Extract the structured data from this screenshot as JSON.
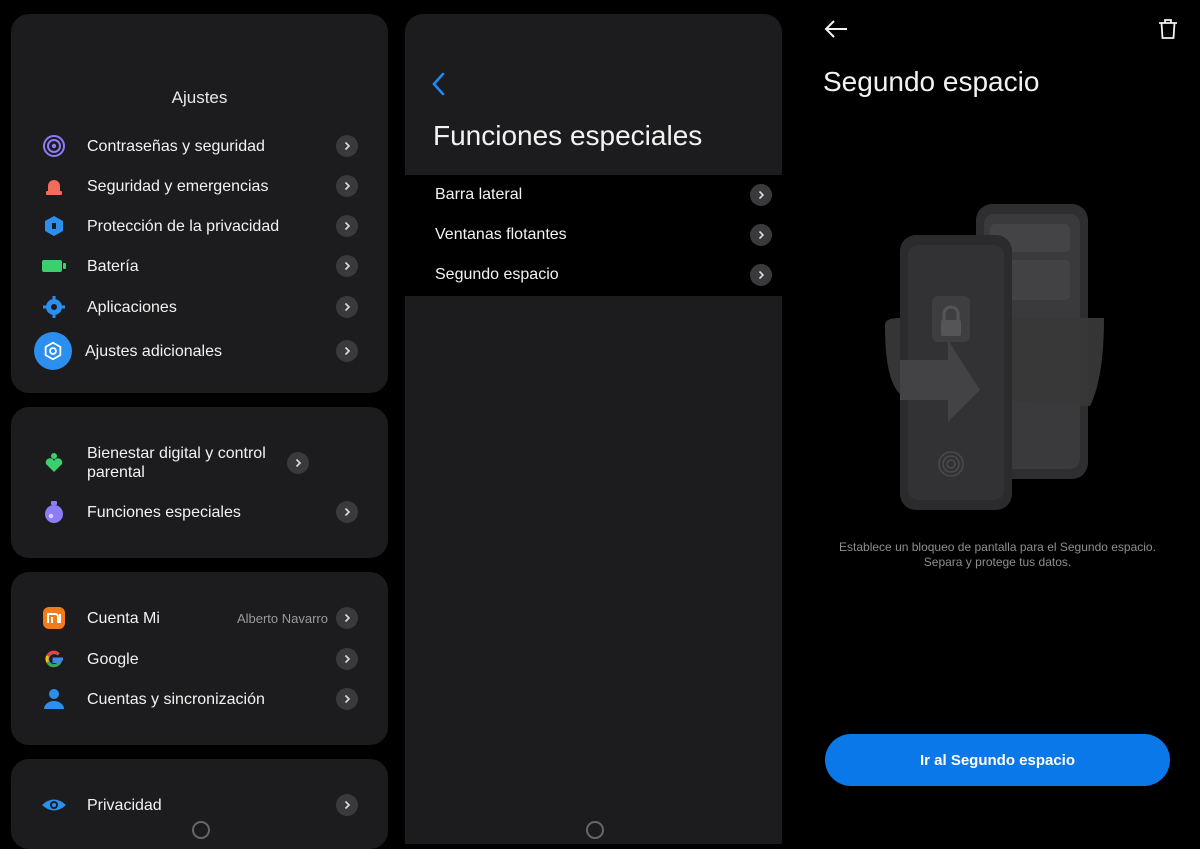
{
  "settings": {
    "title": "Ajustes",
    "group1": [
      {
        "label": "Contraseñas y seguridad",
        "icon": "fingerprint-icon"
      },
      {
        "label": "Seguridad y emergencias",
        "icon": "emergency-bell-icon"
      },
      {
        "label": "Protección de la privacidad",
        "icon": "privacy-shield-icon"
      },
      {
        "label": "Batería",
        "icon": "battery-icon"
      },
      {
        "label": "Aplicaciones",
        "icon": "apps-gear-icon"
      },
      {
        "label": "Ajustes adicionales",
        "icon": "hexagon-settings-icon"
      }
    ],
    "group2": [
      {
        "label": "Bienestar digital y control parental",
        "icon": "wellbeing-icon"
      },
      {
        "label": "Funciones especiales",
        "icon": "special-features-icon"
      }
    ],
    "group3": [
      {
        "label": "Cuenta Mi",
        "value": "Alberto Navarro",
        "icon": "mi-account-icon"
      },
      {
        "label": "Google",
        "icon": "google-icon"
      },
      {
        "label": "Cuentas y sincronización",
        "icon": "accounts-sync-icon"
      }
    ],
    "group4": [
      {
        "label": "Privacidad",
        "icon": "eye-icon"
      }
    ]
  },
  "special": {
    "title": "Funciones especiales",
    "items": [
      {
        "label": "Barra lateral"
      },
      {
        "label": "Ventanas flotantes"
      },
      {
        "label": "Segundo espacio"
      }
    ]
  },
  "second_space": {
    "title": "Segundo espacio",
    "description_line1": "Establece un bloqueo de pantalla para el Segundo espacio.",
    "description_line2": "Separa y protege tus datos.",
    "button_label": "Ir al Segundo espacio"
  },
  "colors": {
    "accent": "#0a78e8",
    "card": "#1c1c1e",
    "background": "#000000"
  }
}
